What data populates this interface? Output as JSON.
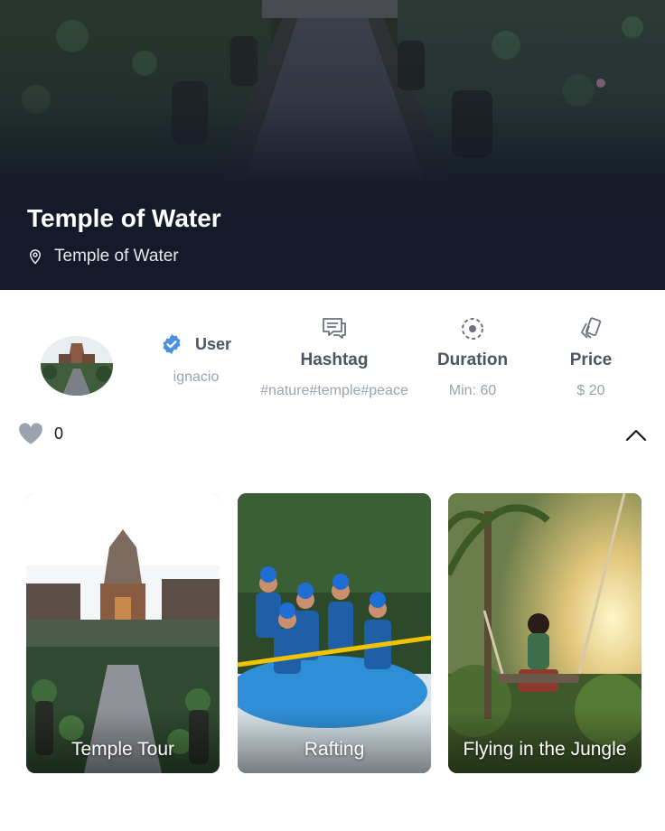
{
  "hero": {
    "title": "Temple of Water",
    "location": "Temple of Water",
    "location_icon": "map-pin-icon"
  },
  "stats": {
    "user": {
      "label": "User",
      "value": "ignacio",
      "icon": "verified-badge-icon",
      "badge_color": "#3b82f6"
    },
    "hashtag": {
      "label": "Hashtag",
      "value": "#nature#temple#peace",
      "icon": "chat-bubbles-icon"
    },
    "duration": {
      "label": "Duration",
      "value": "Min: 60",
      "icon": "timer-dashed-icon"
    },
    "price": {
      "label": "Price",
      "value": "$ 20",
      "icon": "price-tags-icon"
    }
  },
  "likes": {
    "count": "0",
    "icon": "heart-icon",
    "color": "#9ca3af"
  },
  "collapse_icon": "chevron-up-icon",
  "cards": [
    {
      "label": "Temple Tour"
    },
    {
      "label": "Rafting"
    },
    {
      "label": "Flying in the Jungle"
    }
  ],
  "colors": {
    "hero_bg": "#141a29",
    "muted_text": "#9ca3af",
    "label_text": "#4b5563"
  }
}
